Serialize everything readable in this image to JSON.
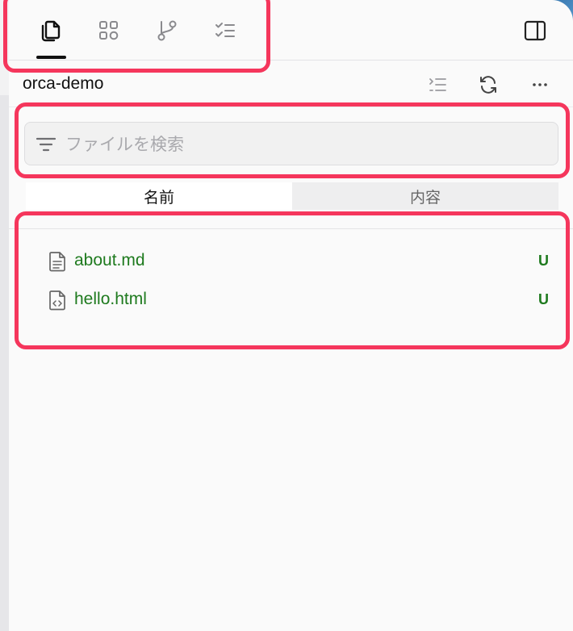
{
  "sidebar_tabs": [
    {
      "icon": "files-icon",
      "active": true
    },
    {
      "icon": "extensions-icon",
      "active": false
    },
    {
      "icon": "source-control-icon",
      "active": false
    },
    {
      "icon": "checklist-icon",
      "active": false
    }
  ],
  "header": {
    "title": "orca-demo",
    "actions": [
      "list-icon",
      "refresh-icon",
      "more-icon"
    ]
  },
  "search": {
    "placeholder": "ファイルを検索",
    "value": ""
  },
  "segment": {
    "options": [
      "名前",
      "内容"
    ],
    "selected": "名前"
  },
  "files": [
    {
      "name": "about.md",
      "status": "U",
      "icon": "markdown-file-icon"
    },
    {
      "name": "hello.html",
      "status": "U",
      "icon": "html-file-icon"
    }
  ],
  "colors": {
    "untracked": "#1e7a1e",
    "annotation": "#f5365c",
    "accent_text": "#111111"
  }
}
